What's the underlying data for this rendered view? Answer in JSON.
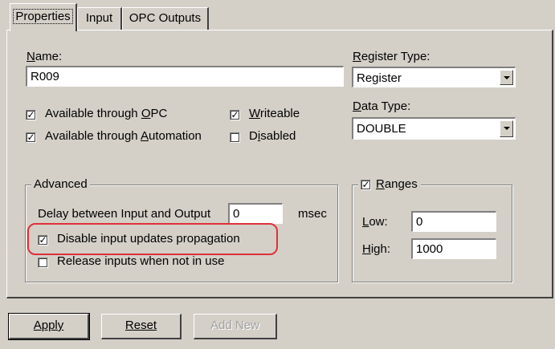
{
  "tabs": [
    {
      "label": "Properties",
      "active": true
    },
    {
      "label": "Input",
      "active": false
    },
    {
      "label": "OPC Outputs",
      "active": false
    }
  ],
  "name": {
    "label": "Name:",
    "value": "R009"
  },
  "register_type": {
    "label": "Register Type:",
    "value": "Register"
  },
  "data_type": {
    "label": "Data Type:",
    "value": "DOUBLE"
  },
  "options": {
    "available_opc": {
      "label": "Available through OPC",
      "checked": true
    },
    "available_automation": {
      "label": "Available through Automation",
      "checked": true
    },
    "writeable": {
      "label": "Writeable",
      "checked": true
    },
    "disabled": {
      "label": "Disabled",
      "checked": false
    }
  },
  "advanced": {
    "title": "Advanced",
    "delay_label": "Delay between Input and Output",
    "delay_value": "0",
    "delay_unit": "msec",
    "disable_propagation": {
      "label": "Disable input updates propagation",
      "checked": true
    },
    "release_inputs": {
      "label": "Release inputs when not in use",
      "checked": false
    }
  },
  "ranges": {
    "title": "Ranges",
    "checked": true,
    "low_label": "Low:",
    "low_value": "0",
    "high_label": "High:",
    "high_value": "1000"
  },
  "buttons": {
    "apply": "Apply",
    "reset": "Reset",
    "add_new": "Add New"
  },
  "colors": {
    "dialog_bg": "#d4d0c8",
    "annotation": "#e0303a"
  }
}
